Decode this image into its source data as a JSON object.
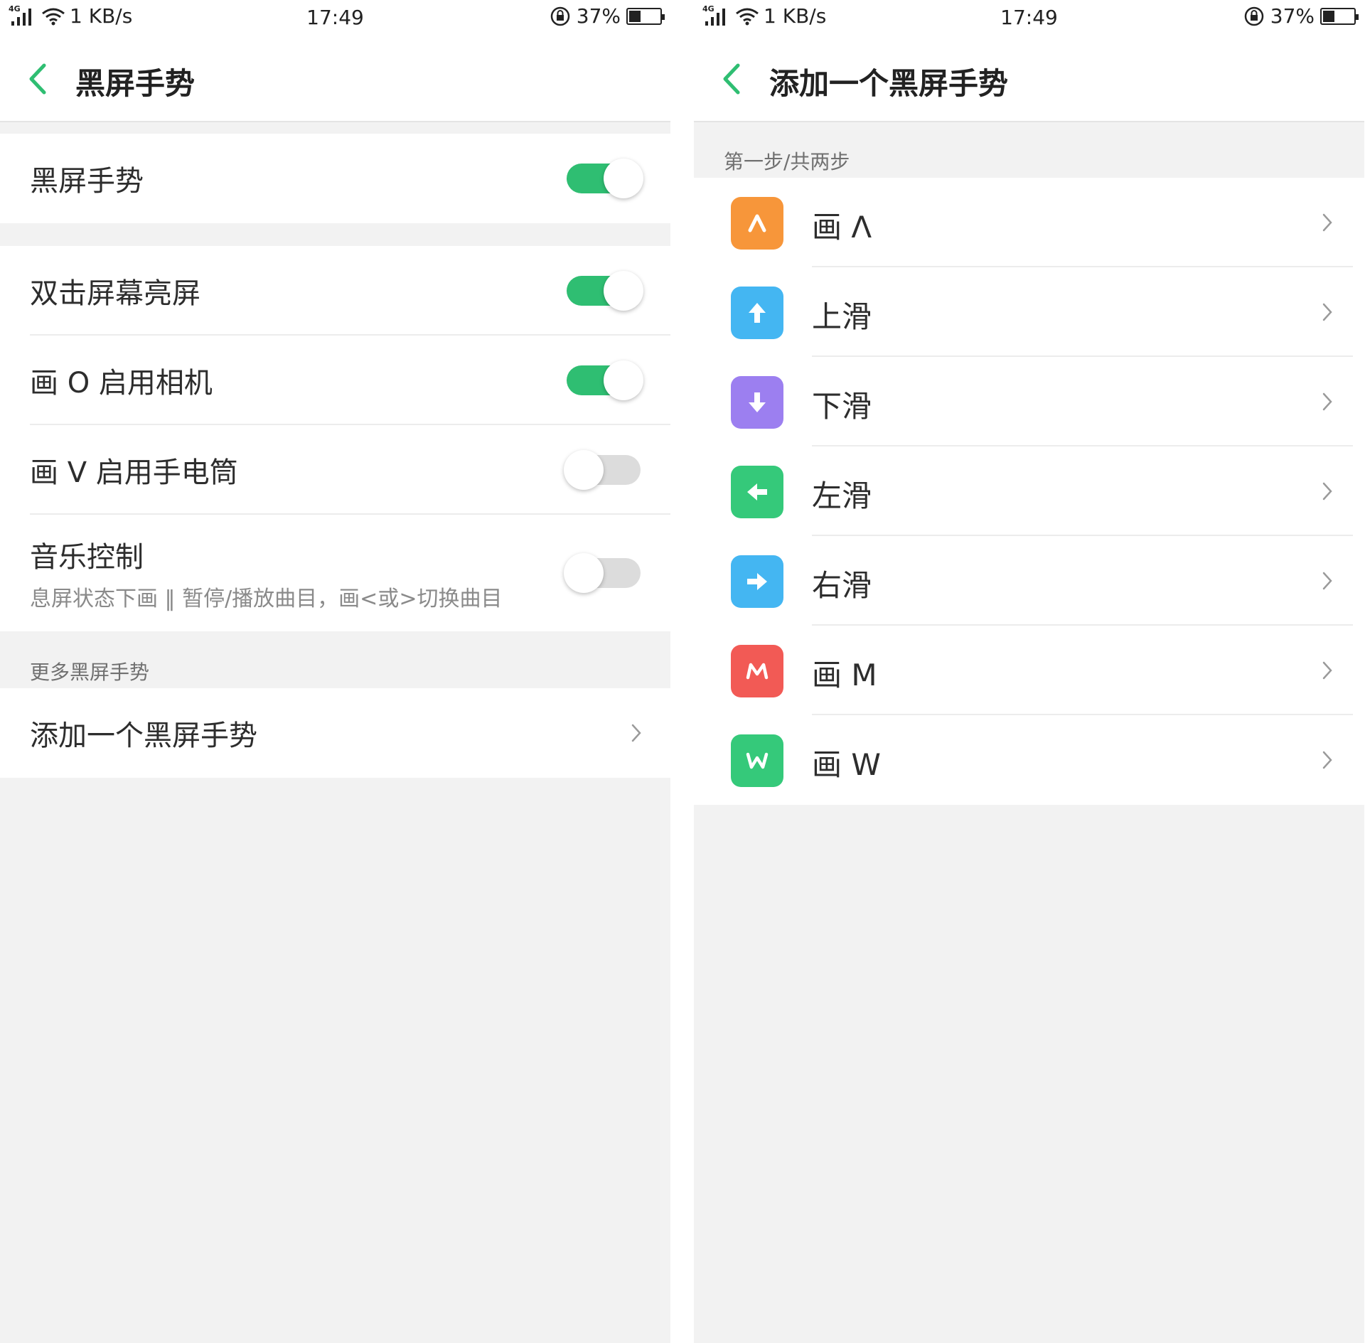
{
  "status_bar": {
    "network": "4G",
    "speed": "1 KB/s",
    "time": "17:49",
    "battery": "37%",
    "battery_level": 0.37
  },
  "left_screen": {
    "title": "黑屏手势",
    "master_toggle": {
      "label": "黑屏手势",
      "on": true
    },
    "settings": [
      {
        "label": "双击屏幕亮屏",
        "on": true
      },
      {
        "label": "画 O 启用相机",
        "on": true
      },
      {
        "label": "画 V 启用手电筒",
        "on": false
      },
      {
        "label": "音乐控制",
        "sublabel": "息屏状态下画 ‖ 暂停/播放曲目，画<或>切换曲目",
        "on": false
      }
    ],
    "more_section_header": "更多黑屏手势",
    "add_gesture_label": "添加一个黑屏手势"
  },
  "right_screen": {
    "title": "添加一个黑屏手势",
    "step_label": "第一步/共两步",
    "gestures": [
      {
        "label": "画 Λ",
        "icon": "caret-up-icon",
        "color": "#f7963a",
        "glyph": "Λ"
      },
      {
        "label": "上滑",
        "icon": "arrow-up-icon",
        "color": "#44b6f2"
      },
      {
        "label": "下滑",
        "icon": "arrow-down-icon",
        "color": "#9c7ff0"
      },
      {
        "label": "左滑",
        "icon": "arrow-left-icon",
        "color": "#35c97a"
      },
      {
        "label": "右滑",
        "icon": "arrow-right-icon",
        "color": "#44b6f2"
      },
      {
        "label": "画 M",
        "icon": "letter-m-icon",
        "color": "#f25a55",
        "glyph": "M"
      },
      {
        "label": "画 W",
        "icon": "letter-w-icon",
        "color": "#35c97a",
        "glyph": "W"
      }
    ]
  },
  "colors": {
    "accent": "#2fbe72",
    "background": "#f2f2f2",
    "separator": "#ececec"
  }
}
